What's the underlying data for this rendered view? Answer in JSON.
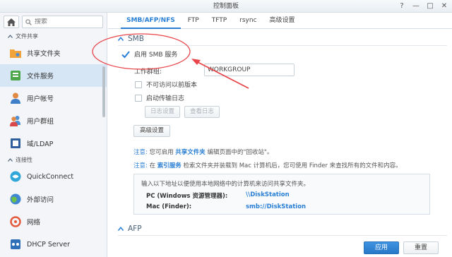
{
  "window": {
    "title": "控制面板",
    "buttons": [
      "?",
      "—",
      "□",
      "✕"
    ]
  },
  "sidebar": {
    "search_placeholder": "搜索",
    "categories": [
      {
        "label": "文件共享"
      },
      {
        "label": "连接性"
      }
    ],
    "items": [
      {
        "label": "共享文件夹",
        "icon": "shared-folder-icon"
      },
      {
        "label": "文件服务",
        "icon": "file-service-icon",
        "active": true
      },
      {
        "label": "用户帐号",
        "icon": "user-icon"
      },
      {
        "label": "用户群组",
        "icon": "group-icon"
      },
      {
        "label": "域/LDAP",
        "icon": "ldap-icon"
      },
      {
        "label": "QuickConnect",
        "icon": "quickconnect-icon"
      },
      {
        "label": "外部访问",
        "icon": "external-access-icon"
      },
      {
        "label": "网络",
        "icon": "network-icon"
      },
      {
        "label": "DHCP Server",
        "icon": "dhcp-icon"
      }
    ]
  },
  "tabs": [
    "SMB/AFP/NFS",
    "FTP",
    "TFTP",
    "rsync",
    "高级设置"
  ],
  "smb": {
    "title": "SMB",
    "enable_label": "启用 SMB 服务",
    "enable_checked": true,
    "workgroup_label": "工作群组:",
    "workgroup_value": "WORKGROUP",
    "prev_versions_label": "不可访问以前版本",
    "transfer_log_label": "启动传输日志",
    "log_settings_btn": "日志设置",
    "view_log_btn": "查看日志",
    "advanced_btn": "高级设置",
    "note1": {
      "label": "注意:",
      "pre": "您可启用 ",
      "link": "共享文件夹",
      "post": " 编辑页面中的\"回收站\"。"
    },
    "note2": {
      "label": "注意:",
      "pre": "在 ",
      "link": "索引服务",
      "post": " 检索文件夹并装载到 Mac 计算机后，您可使用 Finder 来查找所有的文件和内容。"
    },
    "info_title": "输入以下地址以便使用本地网络中的计算机来访问共享文件夹。",
    "pc_label": "PC (Windows 资源管理器):",
    "pc_value": "\\\\DiskStation",
    "mac_label": "Mac (Finder):",
    "mac_value": "smb://DiskStation"
  },
  "afp": {
    "title": "AFP"
  },
  "footer": {
    "apply": "应用",
    "reset": "重置"
  },
  "colors": {
    "accent": "#2a7fd4",
    "annotation": "#e8454a"
  }
}
